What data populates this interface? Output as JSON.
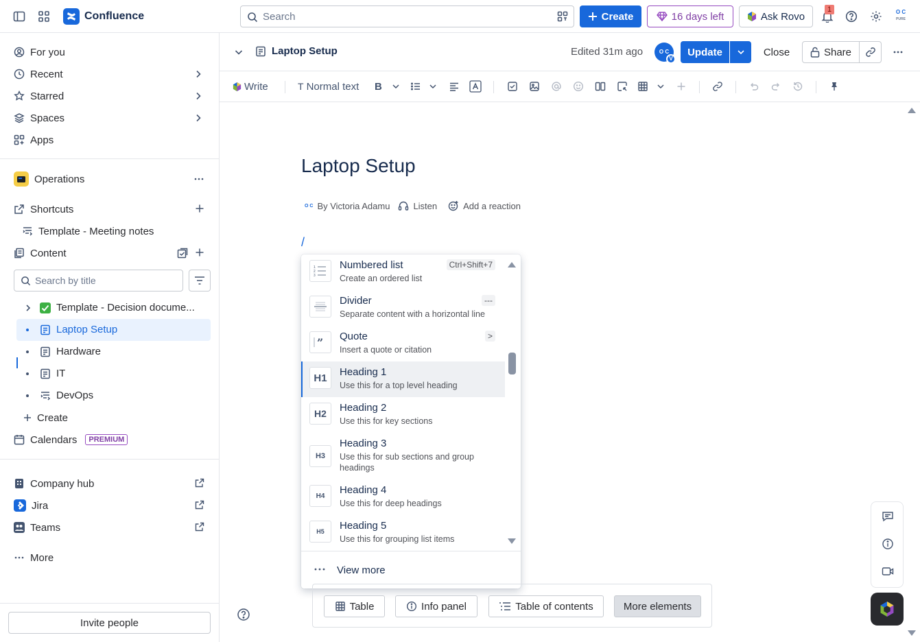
{
  "topbar": {
    "app_name": "Confluence",
    "search_placeholder": "Search",
    "create_label": "Create",
    "trial_label": "16 days left",
    "rovo_label": "Ask Rovo",
    "notification_count": "1",
    "avatar_initials": "O C",
    "avatar_sub": "PURE"
  },
  "sidebar": {
    "nav": [
      {
        "label": "For you",
        "icon": "person-circle-icon"
      },
      {
        "label": "Recent",
        "icon": "clock-icon"
      },
      {
        "label": "Starred",
        "icon": "star-icon"
      },
      {
        "label": "Spaces",
        "icon": "spaces-icon"
      },
      {
        "label": "Apps",
        "icon": "apps-icon"
      }
    ],
    "space_name": "Operations",
    "shortcuts_label": "Shortcuts",
    "shortcut_item": "Template - Meeting notes",
    "content_label": "Content",
    "search_placeholder": "Search by title",
    "tree": [
      {
        "label": "Template - Decision docume...",
        "icon": "check-emoji-icon"
      },
      {
        "label": "Laptop Setup",
        "icon": "page-icon",
        "selected": true
      },
      {
        "label": "Hardware",
        "icon": "page-icon"
      },
      {
        "label": "IT",
        "icon": "page-icon"
      },
      {
        "label": "DevOps",
        "icon": "live-doc-icon"
      }
    ],
    "create_label": "Create",
    "calendars_label": "Calendars",
    "premium_label": "PREMIUM",
    "links": [
      {
        "label": "Company hub",
        "icon": "building-icon"
      },
      {
        "label": "Jira",
        "icon": "jira-icon"
      },
      {
        "label": "Teams",
        "icon": "teams-icon"
      }
    ],
    "more_label": "More",
    "invite_label": "Invite people"
  },
  "page_header": {
    "title": "Laptop Setup",
    "edited": "Edited 31m ago",
    "avatar_initials": "O C",
    "avatar_sub": "V",
    "update_label": "Update",
    "close_label": "Close",
    "share_label": "Share"
  },
  "toolbar": {
    "write_label": "Write",
    "text_style": "Normal text"
  },
  "editor": {
    "title": "Laptop Setup",
    "author": "By Victoria Adamu",
    "author_initials": "O C",
    "listen": "Listen",
    "reaction": "Add a reaction",
    "slash": "/"
  },
  "slash_menu": {
    "items": [
      {
        "title": "Numbered list",
        "desc": "Create an ordered list",
        "shortcut": "Ctrl+Shift+7",
        "icon": "numbered-list-icon"
      },
      {
        "title": "Divider",
        "desc": "Separate content with a horizontal line",
        "shortcut": "---",
        "icon": "divider-icon"
      },
      {
        "title": "Quote",
        "desc": "Insert a quote or citation",
        "shortcut": ">",
        "icon": "quote-icon"
      },
      {
        "title": "Heading 1",
        "desc": "Use this for a top level heading",
        "shortcut": "",
        "icon": "heading-1-icon",
        "glyph": "H1"
      },
      {
        "title": "Heading 2",
        "desc": "Use this for key sections",
        "shortcut": "",
        "icon": "heading-2-icon",
        "glyph": "H2"
      },
      {
        "title": "Heading 3",
        "desc": "Use this for sub sections and group headings",
        "shortcut": "",
        "icon": "heading-3-icon",
        "glyph": "H3"
      },
      {
        "title": "Heading 4",
        "desc": "Use this for deep headings",
        "shortcut": "",
        "icon": "heading-4-icon",
        "glyph": "H4"
      },
      {
        "title": "Heading 5",
        "desc": "Use this for grouping list items",
        "shortcut": "",
        "icon": "heading-5-icon",
        "glyph": "H5"
      }
    ],
    "active_index": 3,
    "view_more": "View more"
  },
  "elements": {
    "table": "Table",
    "info_panel": "Info panel",
    "toc": "Table of contents",
    "more": "More elements"
  },
  "colors": {
    "brand": "#1868db",
    "premium": "#803fa5"
  }
}
